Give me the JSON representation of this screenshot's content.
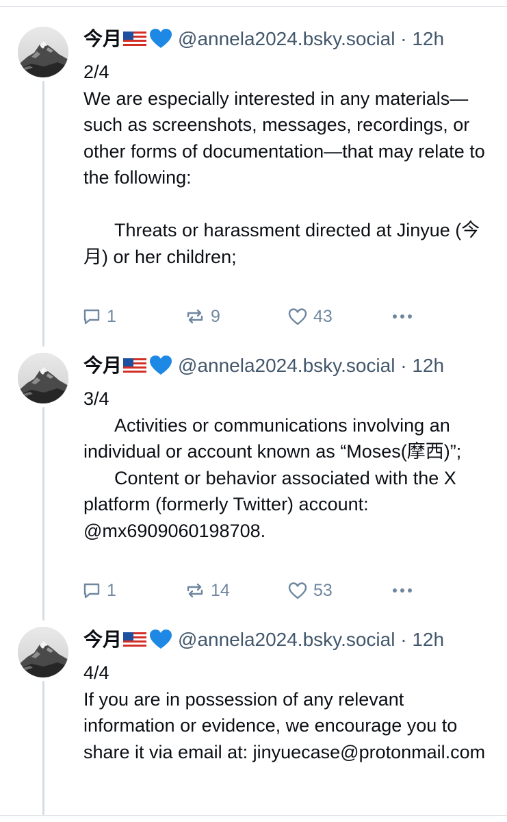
{
  "posts": [
    {
      "display_name": "今月",
      "flag": "us-flag",
      "heart": "blue-heart-emoji",
      "handle": "@annela2024.bsky.social",
      "time": "· 12h",
      "text": "2/4\nWe are especially interested in any materials—such as screenshots, messages, recordings, or other forms of documentation—that may relate to the following:\n\n\tThreats or harassment directed at Jinyue (今月) or her children;",
      "replies": "1",
      "reposts": "9",
      "likes": "43"
    },
    {
      "display_name": "今月",
      "flag": "us-flag",
      "heart": "blue-heart-emoji",
      "handle": "@annela2024.bsky.social",
      "time": "· 12h",
      "text": "3/4\n\tActivities or communications involving an individual or account known as “Moses(摩西)”;\n\tContent or behavior associated with the X platform (formerly Twitter) account: @mx6909060198708.",
      "replies": "1",
      "reposts": "14",
      "likes": "53"
    },
    {
      "display_name": "今月",
      "flag": "us-flag",
      "heart": "blue-heart-emoji",
      "handle": "@annela2024.bsky.social",
      "time": "· 12h",
      "text": "4/4\nIf you are in possession of any relevant information or evidence, we encourage you to share it via email at: jinyuecase@protonmail.com"
    }
  ],
  "icons": {
    "reply": "reply-icon",
    "repost": "repost-icon",
    "like": "heart-icon",
    "more": "more-options-icon"
  },
  "colors": {
    "text": "#0b0f14",
    "muted": "#42576c",
    "action": "#6f869f",
    "thread_line": "#d6dde5"
  }
}
